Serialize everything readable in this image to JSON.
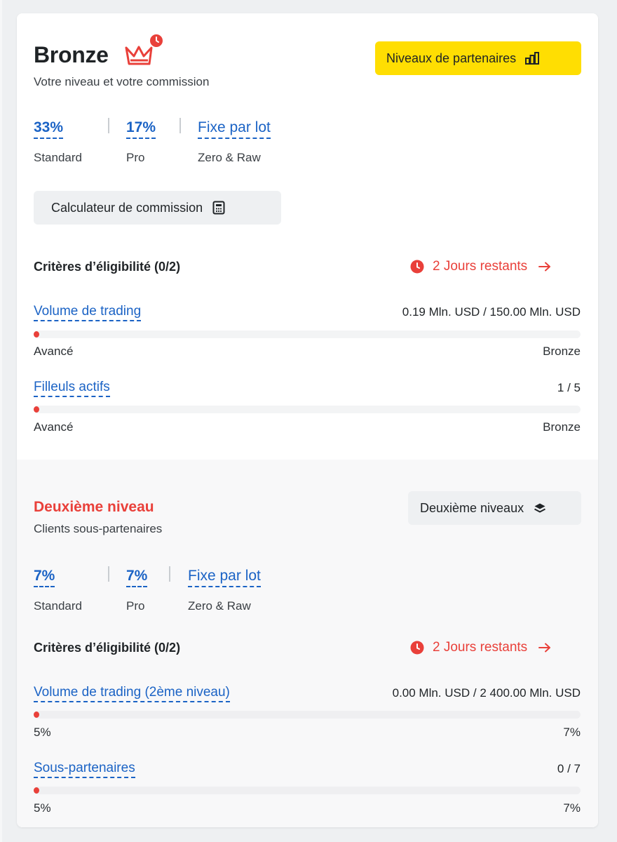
{
  "tier": {
    "name": "Bronze",
    "subtitle": "Votre niveau et votre commission",
    "partner_levels_button": "Niveaux de partenaires",
    "rates": [
      {
        "value": "33%",
        "label": "Standard"
      },
      {
        "value": "17%",
        "label": "Pro"
      },
      {
        "value": "Fixe par lot",
        "label": "Zero & Raw"
      }
    ],
    "calculator_button": "Calculateur de commission",
    "criteria": {
      "title": "Critères d’éligibilité (0/2)",
      "days_remaining": "2 Jours restants",
      "metrics": [
        {
          "label": "Volume de trading",
          "current": "0.19 Mln. USD",
          "separator": "/",
          "target": "150.00 Mln. USD",
          "progress": 0.0013,
          "left_label": "Avancé",
          "right_label": "Bronze"
        },
        {
          "label": "Filleuls actifs",
          "value": "1 / 5",
          "progress": 0.0,
          "left_label": "Avancé",
          "right_label": "Bronze"
        }
      ]
    }
  },
  "second_level": {
    "title": "Deuxième niveau",
    "subtitle": "Clients sous-partenaires",
    "button": "Deuxième niveaux",
    "rates": [
      {
        "value": "7%",
        "label": "Standard"
      },
      {
        "value": "7%",
        "label": "Pro"
      },
      {
        "value": "Fixe par lot",
        "label": "Zero & Raw"
      }
    ],
    "criteria": {
      "title": "Critères d’éligibilité (0/2)",
      "days_remaining": "2 Jours restants",
      "metrics": [
        {
          "label": "Volume de trading (2ème niveau)",
          "current": "0.00 Mln. USD",
          "separator": "/",
          "target": "2 400.00 Mln. USD",
          "progress": 0.0,
          "left_label": "5%",
          "right_label": "7%"
        },
        {
          "label": "Sous-partenaires",
          "value": "0 / 7",
          "progress": 0.0,
          "left_label": "5%",
          "right_label": "7%"
        }
      ]
    }
  },
  "colors": {
    "accent_yellow": "#ffde02",
    "link_blue": "#1b63c5",
    "alert_red": "#e9403a"
  },
  "icons": {
    "crown": "crown-icon",
    "clock_badge": "clock-badge-icon",
    "bar_chart": "bar-chart-icon",
    "calculator": "calculator-icon",
    "clock": "clock-icon",
    "arrow_right": "arrow-right-icon",
    "layers": "layers-icon"
  }
}
